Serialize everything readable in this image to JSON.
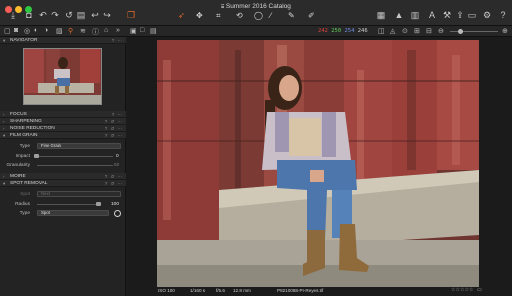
{
  "window": {
    "title": "Summer 2016 Catalog",
    "title_icon": "catalog-icon"
  },
  "toolbar": {
    "left_icons": [
      "import-icon",
      "camera-icon",
      "undo-icon",
      "redo-icon",
      "reset-icon",
      "trash-icon",
      "back-icon",
      "forward-icon",
      "variant-icon"
    ],
    "cursor_tools": [
      "pointer-icon",
      "pan-icon",
      "crop-icon",
      "rotate-icon",
      "spot-icon",
      "line-icon",
      "picker-icon",
      "brush-icon"
    ],
    "right_icons": [
      "grid-icon",
      "warning-icon",
      "columns-icon",
      "text-icon",
      "hammer-icon",
      "export-icon",
      "print-icon",
      "cloud-icon",
      "gear-icon",
      "help-icon"
    ]
  },
  "readout": {
    "r": "242",
    "g": "250",
    "b": "254",
    "a": "246"
  },
  "navigator": {
    "title": "NAVIGATOR"
  },
  "sections": {
    "focus": "FOCUS",
    "sharpening": "SHARPENING",
    "noise_reduction": "NOISE REDUCTION",
    "film_grain": "FILM GRAIN",
    "moire": "MOIRE",
    "spot_removal": "SPOT REMOVAL"
  },
  "film_grain": {
    "type_label": "Type",
    "type_value": "Fine Grain",
    "impact_label": "Impact",
    "impact_value": "0",
    "granularity_label": "Granularity",
    "granularity_value": "50"
  },
  "spot_removal": {
    "spot_label": "Spot",
    "spot_value": "Next",
    "radius_label": "Radius",
    "radius_value": "100",
    "type_label": "Type",
    "type_value": "Spot"
  },
  "status": {
    "iso": "ISO 100",
    "shutter": "1/160 s",
    "aperture": "f/5.6",
    "focal": "12.8 mm",
    "filename": "P8210088-PI-Reyes.tif"
  },
  "colors": {
    "accent": "#e36b2c",
    "red": "#e0443b",
    "green": "#5fcf59",
    "blue": "#6e8ee6"
  }
}
